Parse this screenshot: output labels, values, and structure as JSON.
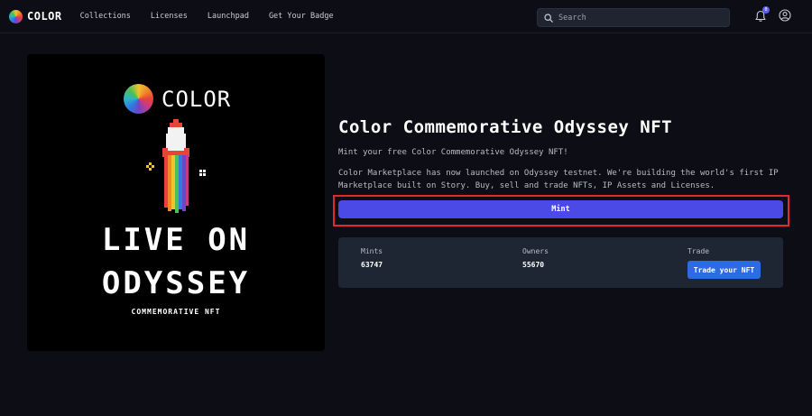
{
  "nav": {
    "brand": "COLOR",
    "links": [
      "Collections",
      "Licenses",
      "Launchpad",
      "Get Your Badge"
    ],
    "search_placeholder": "Search",
    "notification_count": "0"
  },
  "hero": {
    "brand": "COLOR",
    "line1": "LIVE ON",
    "line2": "ODYSSEY",
    "subtitle": "COMMEMORATIVE NFT"
  },
  "main": {
    "title": "Color Commemorative Odyssey NFT",
    "subtitle": "Mint your free Color Commemorative Odyssey NFT!",
    "description": "Color Marketplace has now launched on Odyssey testnet. We're building the world's first IP Marketplace built on Story. Buy, sell and trade NFTs, IP Assets and Licenses.",
    "mint_label": "Mint"
  },
  "stats": {
    "mints_label": "Mints",
    "mints_value": "63747",
    "owners_label": "Owners",
    "owners_value": "55670",
    "trade_label": "Trade",
    "trade_button": "Trade your NFT"
  },
  "colors": {
    "background": "#0d0e15",
    "mint_button": "#4c4ae6",
    "trade_button": "#2d6be4",
    "highlight": "#e12a2a",
    "stats_panel": "#1f2633"
  },
  "icons": [
    "search-icon",
    "bell-icon",
    "user-icon",
    "color-wheel-logo",
    "rocket-icon"
  ]
}
